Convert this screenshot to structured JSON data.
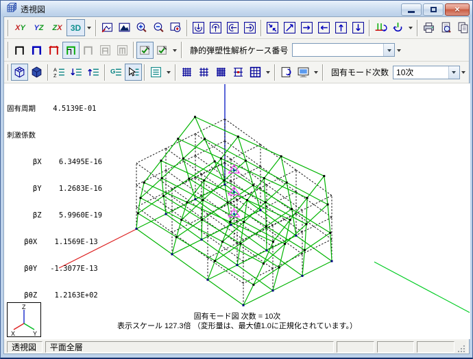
{
  "window": {
    "title": "透視図"
  },
  "toolbar1": {
    "xy_x": "X",
    "xy_y": "Y",
    "yz_y": "Y",
    "yz_z": "Z",
    "zx_z": "Z",
    "zx_x": "X",
    "threed": "3D"
  },
  "toolbar2": {
    "case_label": "静的弾塑性解析ケース番号",
    "case_value": ""
  },
  "toolbar3": {
    "mode_label": "固有モード次数",
    "mode_value": "10次"
  },
  "overlay": {
    "lines": [
      "固有周期    4.5139E-01",
      "刺激係数",
      "      βX    6.3495E-16",
      "      βY    1.2683E-16",
      "      βZ    5.9960E-19",
      "    βθX    1.1569E-13",
      "    βθY   -1.3077E-13",
      "    βθZ    1.2163E+02"
    ]
  },
  "caption": {
    "line1": "固有モード図 次数 = 10次",
    "line2": "表示スケール 127.3倍 （変形量は、最大値1.0に正規化されています。）"
  },
  "statusbar": {
    "view": "透視図",
    "plane": "平面全層"
  },
  "gizmo": {
    "x": "X",
    "y": "Y",
    "z": "Z"
  },
  "colors": {
    "model_green": "#00b400",
    "dashed_black": "#111111",
    "axis_x": "#dd2222",
    "axis_y": "#00cc22",
    "axis_z": "#2233cc",
    "marker_magenta": "#ff44ff",
    "marker_cyan": "#00bbbb",
    "node_black": "#000000",
    "node_navy": "#000080"
  }
}
